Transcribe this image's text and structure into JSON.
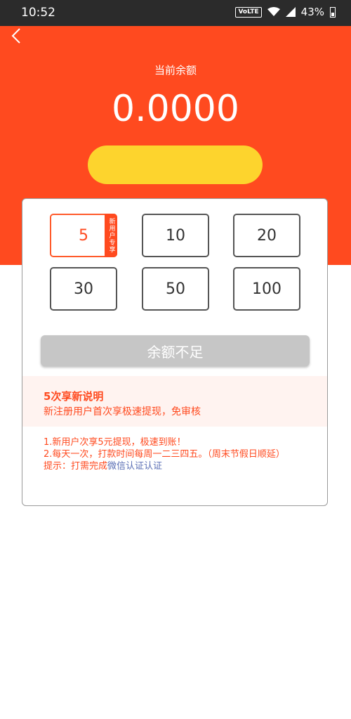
{
  "status_bar": {
    "time": "10:52",
    "network_badge": "VoLTE",
    "battery": "43%"
  },
  "header": {
    "balance_label": "当前余额",
    "balance_value": "0.0000"
  },
  "amounts": [
    {
      "value": "5",
      "selected": true,
      "tag": "新用户专享"
    },
    {
      "value": "10"
    },
    {
      "value": "20"
    },
    {
      "value": "30"
    },
    {
      "value": "50"
    },
    {
      "value": "100"
    }
  ],
  "withdraw_button": "余额不足",
  "notice": {
    "title": "5次享新说明",
    "body": "新注册用户首次享极速提现，免审核"
  },
  "rules": {
    "line1": "1.新用户次享5元提现，极速到账！",
    "line2": "2.每天一次，打款时间每周一二三四五。（周末节假日顺延）",
    "line3_prefix": "提示：打需完成",
    "line3_link": "微信认证认证"
  },
  "colors": {
    "header_bg": "#ff4a1f",
    "accent": "#ff4a1f",
    "yellow_button": "#fdd42d",
    "disabled_button": "#c6c6c6"
  }
}
